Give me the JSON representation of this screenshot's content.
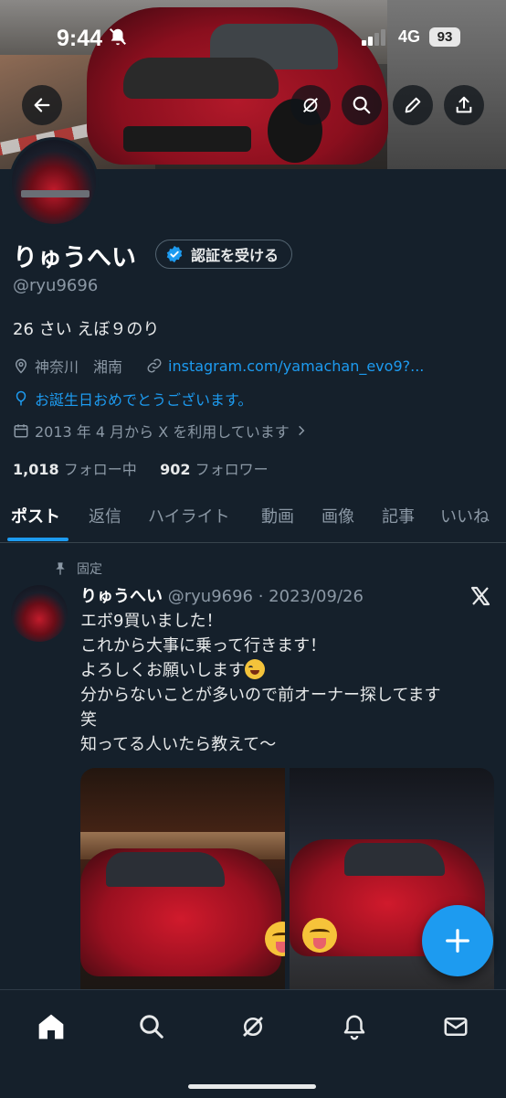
{
  "status_bar": {
    "time": "9:44",
    "network": "4G",
    "battery": "93"
  },
  "profile": {
    "name": "りゅうへい",
    "verify_button": "認証を受ける",
    "handle": "@ryu9696",
    "bio": "26 さい えぼ９のり",
    "location": "神奈川　湘南",
    "link": "instagram.com/yamachan_evo9?...",
    "birthday": "お誕生日おめでとうございます。",
    "joined": "2013 年 4 月から X を利用しています",
    "following_count": "1,018",
    "following_label": "フォロー中",
    "followers_count": "902",
    "followers_label": "フォロワー"
  },
  "tabs": [
    "ポスト",
    "返信",
    "ハイライト",
    "動画",
    "画像",
    "記事",
    "いいね"
  ],
  "post": {
    "pinned_label": "固定",
    "author": "りゅうへい",
    "meta": "@ryu9696 · 2023/09/26",
    "lines": [
      "エボ9買いました！",
      "これから大事に乗って行きます！",
      "よろしくお願いします",
      "分からないことが多いので前オーナー探してます",
      "笑",
      "知ってる人いたら教えて〜"
    ]
  },
  "colors": {
    "background": "#15202b",
    "accent": "#1d9bf0",
    "muted": "#8b98a5",
    "text": "#e7e9ea"
  },
  "icons": [
    "back-arrow-icon",
    "grok-icon",
    "search-icon",
    "edit-icon",
    "share-icon",
    "verified-badge-icon",
    "location-icon",
    "link-icon",
    "balloon-icon",
    "calendar-icon",
    "pin-icon",
    "x-logo-icon",
    "plus-icon",
    "home-icon",
    "bell-icon",
    "mail-icon"
  ]
}
